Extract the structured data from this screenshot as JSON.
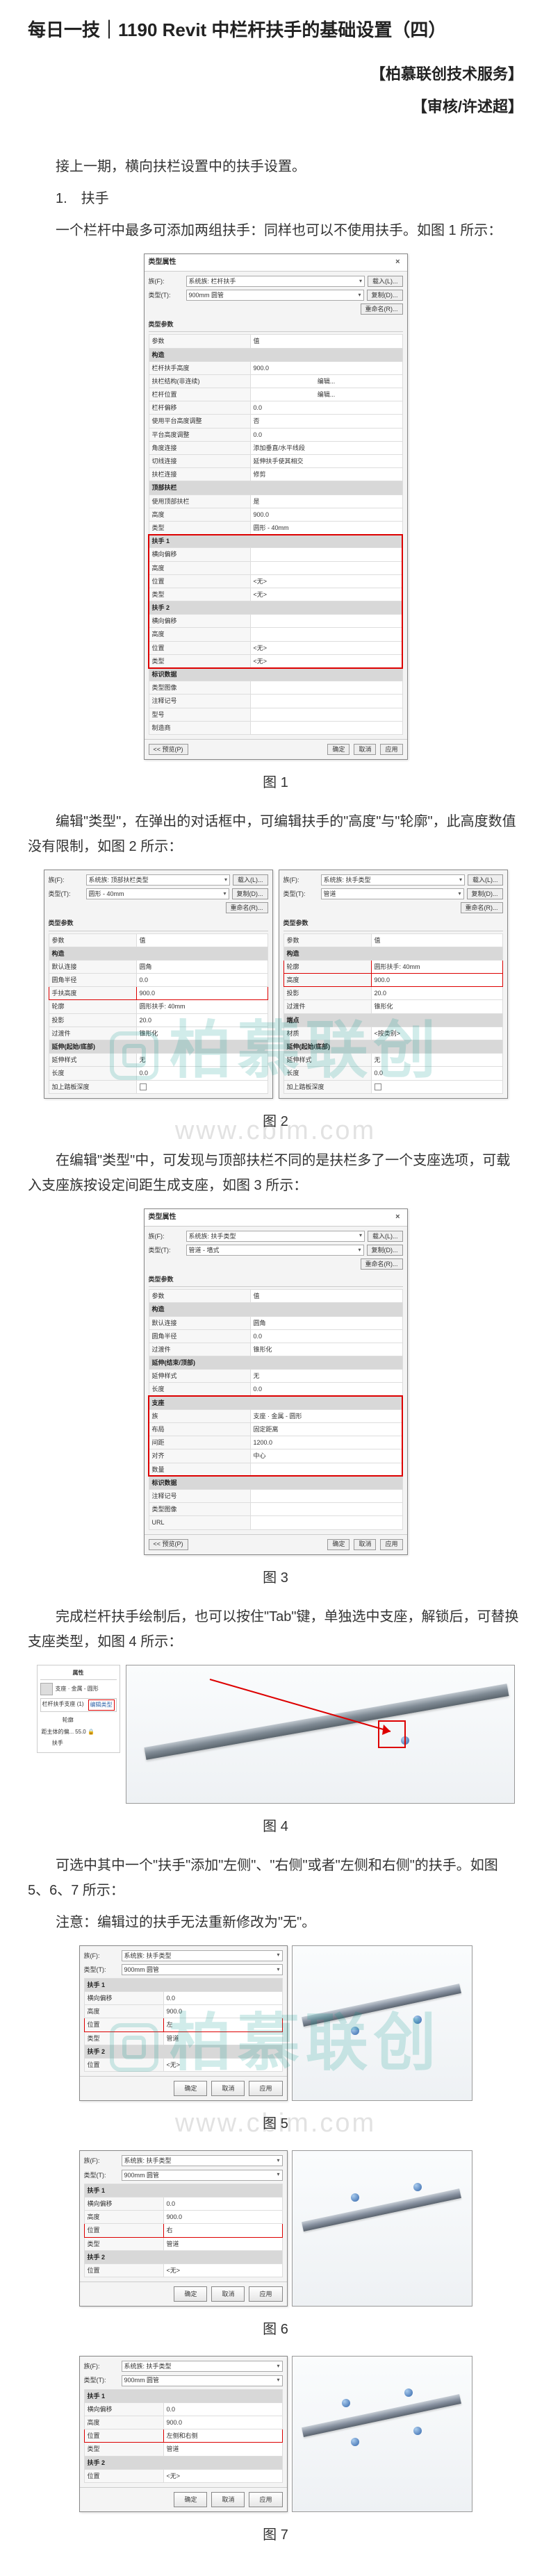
{
  "header": {
    "title": "每日一技｜1190 Revit 中栏杆扶手的基础设置（四）",
    "service": "【柏慕联创技术服务】",
    "author": "【审核/许述超】"
  },
  "intro": {
    "p1": "接上一期，横向扶栏设置中的扶手设置。",
    "item1": "1.　扶手",
    "p2": "一个栏杆中最多可添加两组扶手：同样也可以不使用扶手。如图 1 所示："
  },
  "dialog_common": {
    "title": "类型属性",
    "close": "×",
    "family_lbl": "族(F):",
    "type_lbl": "类型(T):",
    "family_val": "系统族: 栏杆扶手",
    "type_val": "900mm 圆管",
    "load_btn": "载入(L)...",
    "dup_btn": "复制(D)...",
    "rename_btn": "重命名(R)...",
    "param_header": "类型参数",
    "col_param": "参数",
    "col_value": "值",
    "ok": "确定",
    "cancel": "取消",
    "apply": "应用",
    "preview_btn": "<< 预览(P)"
  },
  "fig1": {
    "groups": {
      "struct": "构造",
      "top": "顶部扶栏",
      "hand1": "扶手 1",
      "hand2": "扶手 2",
      "ident": "标识数据"
    },
    "rows": {
      "rail_height": "栏杆扶手高度",
      "rail_struct": "扶栏结构(非连续)",
      "pos": "栏杆位置",
      "offset": "栏杆偏移",
      "use_land": "使用平台高度调整",
      "land_h": "平台高度调整",
      "angle": "角度连接",
      "tangent": "切线连接",
      "rail_conn": "扶栏连接",
      "use_top": "使用顶部扶栏",
      "height": "高度",
      "type": "类型",
      "lat_offset": "横向偏移",
      "position": "位置",
      "img": "类型图像",
      "keynote": "注释记号",
      "model": "型号",
      "manuf": "制造商"
    },
    "vals": {
      "empty": "",
      "edit": "编辑...",
      "num0": "0.0",
      "no": "否",
      "height900": "900.0",
      "addseg": "添加垂直/水平线段",
      "ext": "延伸扶手使其相交",
      "trim": "修剪",
      "yes": "是",
      "round40": "圆形 - 40mm",
      "none": "<无>"
    }
  },
  "caption": {
    "fig1": "图 1",
    "fig2": "图 2",
    "fig3": "图 3",
    "fig4": "图 4",
    "fig5": "图 5",
    "fig6": "图 6",
    "fig7": "图 7"
  },
  "para2": "编辑\"类型\"，在弹出的对话框中，可编辑扶手的\"高度\"与\"轮廓\"，此高度数值没有限制，如图 2 所示：",
  "fig2": {
    "family_val_top": "系统族: 顶部扶栏类型",
    "type_val_top": "圆形 - 40mm",
    "family_val_hand": "系统族: 扶手类型",
    "type_val_hand": "管道",
    "groups": {
      "struct": "构造",
      "ext": "延伸(起始/底部)",
      "term": "端点"
    },
    "rows": {
      "default_conn": "默认连接",
      "corner_r": "圆角半径",
      "hand_height": "手扶高度",
      "profile": "轮廓",
      "projection": "投影",
      "transition": "过渡件",
      "height": "高度",
      "ext_style": "延伸样式",
      "length": "长度",
      "plus": "加上踏板深度",
      "material": "材质"
    },
    "vals": {
      "corner": "圆角",
      "r0": "0.0",
      "h900": "900.0",
      "profile_circle": "圆形扶手: 40mm",
      "proj20": "20.0",
      "cone": "锥形化",
      "none_ext": "无",
      "chk": "□",
      "default": "<按类别>"
    }
  },
  "para3": "在编辑\"类型\"中，可发现与顶部扶栏不同的是扶栏多了一个支座选项，可载入支座族按设定间距生成支座，如图 3 所示：",
  "fig3": {
    "family_val": "系统族: 扶手类型",
    "type_val": "管道 - 墙式",
    "groups": {
      "ext_end": "延伸(结束/顶部)",
      "support": "支座"
    },
    "rows": {
      "ext_style": "延伸样式",
      "length": "长度",
      "family": "族",
      "layout": "布局",
      "spacing": "间距",
      "adjust": "对齐",
      "num": "数量"
    },
    "vals": {
      "none": "无",
      "zero": "0.0",
      "supp_fam": "支座 · 金属 - 圆形",
      "fixed": "固定距离",
      "sp1200": "1200.0",
      "center": "中心"
    }
  },
  "para4": "完成栏杆扶手绘制后，也可以按住\"Tab\"键，单独选中支座，解锁后，可替换支座类型，如图 4 所示：",
  "fig4": {
    "props_title": "属性",
    "type_name": "支座 · 金属 - 圆形",
    "edit_type": "编辑类型",
    "sel_count": "栏杆扶手支座 (1)",
    "rows": {
      "section": "轮廓",
      "host_off": "距主体的偏... ",
      "hand": "扶手"
    },
    "vals": {
      "locked": "55.0",
      "unlocked_icon": "🔒"
    }
  },
  "para5": "可选中其中一个\"扶手\"添加\"左侧\"、\"右侧\"或者\"左侧和右侧\"的扶手。如图 5、6、7 所示：",
  "para6": "注意：编辑过的扶手无法重新修改为\"无\"。",
  "fig5_7": {
    "pos_row": "位置",
    "pos_left": "左",
    "pos_right": "右",
    "pos_both": "左侧和右侧",
    "type_pipe": "管道"
  },
  "watermark": {
    "main": "柏慕联创",
    "sub": "www.cbim.com"
  }
}
